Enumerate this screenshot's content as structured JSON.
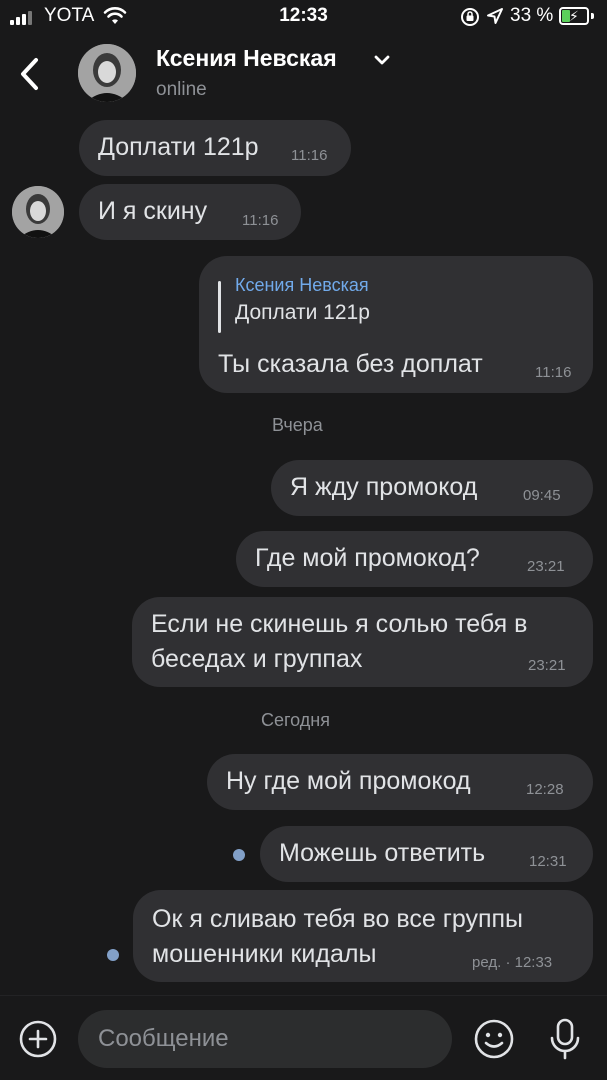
{
  "status_bar": {
    "carrier": "YOTA",
    "time": "12:33",
    "battery": "33 %"
  },
  "header": {
    "contact_name": "Ксения Невская",
    "contact_status": "online"
  },
  "messages": [
    {
      "text": "Доплати 121р",
      "time": "11:16",
      "direction": "incoming"
    },
    {
      "text": "И я скину",
      "time": "11:16",
      "direction": "incoming"
    },
    {
      "reply_to_name": "Ксения Невская",
      "reply_to_text": "Доплати 121р",
      "text": "Ты сказала без доплат",
      "time": "11:16",
      "direction": "outgoing"
    },
    {
      "date_separator": "Вчера"
    },
    {
      "text": "Я жду промокод",
      "time": "09:45",
      "direction": "outgoing"
    },
    {
      "text": "Где мой промокод?",
      "time": "23:21",
      "direction": "outgoing"
    },
    {
      "text_lines": [
        "Если не скинешь я солью тебя в",
        "беседах и группах"
      ],
      "time": "23:21",
      "direction": "outgoing"
    },
    {
      "date_separator": "Сегодня"
    },
    {
      "text": "Ну где мой промокод",
      "time": "12:28",
      "direction": "outgoing"
    },
    {
      "text": "Можешь ответить",
      "time": "12:31",
      "direction": "outgoing",
      "unread": true
    },
    {
      "text_lines": [
        "Ок я сливаю тебя во все группы",
        "мошенники кидалы"
      ],
      "time": "ред. · 12:33",
      "direction": "outgoing",
      "unread": true
    }
  ],
  "composer": {
    "placeholder": "Сообщение"
  },
  "icons": {
    "back": "chevron-left-icon",
    "name_dropdown": "chevron-down-icon",
    "attach": "plus-circle-icon",
    "emoji": "smile-icon",
    "voice": "microphone-icon"
  },
  "colors": {
    "background": "#19191a",
    "bubble": "#303033",
    "accent_link": "#71aaeb",
    "unread_dot": "#82a0c8",
    "secondary_text": "#8e9196"
  }
}
